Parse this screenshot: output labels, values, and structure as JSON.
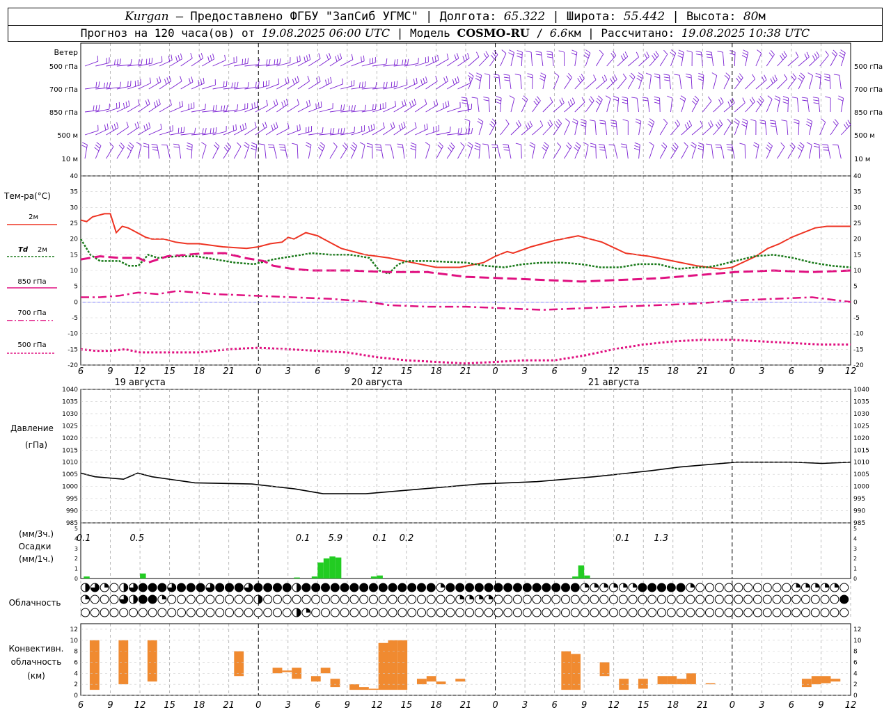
{
  "header": {
    "station": "Kurgan",
    "provider": " – Предоставлено ФГБУ \"ЗапСиб УГМС\" | Долгота: ",
    "lon": "65.322",
    "lat_label": " | Широта: ",
    "lat": "55.442",
    "alt_label": " | Высота: ",
    "alt": "80",
    "alt_unit": "м",
    "line2_a": "Прогноз на 120 часа(ов) от ",
    "issued": "19.08.2025 06:00 UTC",
    "line2_b": "  | Модель ",
    "model": "COSMO-RU",
    "line2_c": " / ",
    "res": "6.6",
    "res_unit": "км | Рассчитано: ",
    "computed": "19.08.2025 10:38 UTC"
  },
  "colors": {
    "wind": "#7a1fd2",
    "t2m": "#ee3322",
    "td2m": "#1a7a1a",
    "t850": "#e01080",
    "pressure": "#000000",
    "precip": "#22cc22",
    "conv": "#f08a30",
    "zero": "#3333ff"
  },
  "labels": {
    "wind": {
      "title": "Ветер",
      "levels": [
        "500 гПа",
        "700 гПа",
        "850 гПа",
        "500 м",
        "10  м"
      ]
    },
    "temp": {
      "title": "Тем-ра(°C)",
      "l2m": "2м",
      "ltd": "Td",
      "ltd2": "2м",
      "l850": "850 гПа",
      "l700": "700 гПа",
      "l500": "500 гПа"
    },
    "pressure": {
      "line1": "Давление",
      "line2": "(гПа)"
    },
    "precip": {
      "line1": "(мм/3ч.)",
      "line2": "Осадки",
      "line3": "(мм/1ч.)"
    },
    "cloud": {
      "title": "Облачность"
    },
    "conv": {
      "line1": "Конвективн.",
      "line2": "облачность",
      "line3": "(км)"
    },
    "days": [
      "19 августа",
      "20 августа",
      "21 августа"
    ]
  },
  "chart_data": {
    "type": "meteogram",
    "x_hours": [
      6,
      9,
      12,
      15,
      18,
      21,
      0,
      3,
      6,
      9,
      12,
      15,
      18,
      21,
      0,
      3,
      6,
      9,
      12,
      15,
      18,
      21,
      0,
      3,
      6,
      9,
      12
    ],
    "temperature": {
      "ylim": [
        -20,
        40
      ],
      "ticks": [
        -20,
        -15,
        -10,
        -5,
        0,
        5,
        10,
        15,
        20,
        25,
        30,
        35,
        40
      ],
      "t2m": [
        [
          0,
          26
        ],
        [
          1,
          25.5
        ],
        [
          2,
          27
        ],
        [
          3,
          27.5
        ],
        [
          4,
          28
        ],
        [
          5,
          28
        ],
        [
          6,
          22
        ],
        [
          7,
          24
        ],
        [
          8,
          23.5
        ],
        [
          9,
          22.5
        ],
        [
          10,
          21.5
        ],
        [
          11,
          20.5
        ],
        [
          12,
          20
        ],
        [
          14,
          20
        ],
        [
          16,
          19
        ],
        [
          18,
          18.5
        ],
        [
          20,
          18.5
        ],
        [
          24,
          17.5
        ],
        [
          28,
          17
        ],
        [
          30,
          17.5
        ],
        [
          32,
          18.5
        ],
        [
          34,
          19
        ],
        [
          35,
          20.5
        ],
        [
          36,
          20
        ],
        [
          38,
          22
        ],
        [
          40,
          21
        ],
        [
          42,
          19
        ],
        [
          44,
          17
        ],
        [
          46,
          16
        ],
        [
          48,
          15
        ],
        [
          52,
          14
        ],
        [
          56,
          12.5
        ],
        [
          60,
          11
        ],
        [
          64,
          11
        ],
        [
          68,
          12.5
        ],
        [
          70,
          14.5
        ],
        [
          72,
          16
        ],
        [
          73,
          15.5
        ],
        [
          76,
          17.5
        ],
        [
          80,
          19.5
        ],
        [
          84,
          21
        ],
        [
          88,
          19
        ],
        [
          92,
          15.5
        ],
        [
          96,
          14.5
        ],
        [
          100,
          13
        ],
        [
          104,
          11.5
        ],
        [
          108,
          10.5
        ],
        [
          110,
          11
        ],
        [
          114,
          14.5
        ],
        [
          116,
          17
        ],
        [
          118,
          18.5
        ],
        [
          120,
          20.5
        ],
        [
          124,
          23.5
        ],
        [
          126,
          24
        ],
        [
          130,
          24
        ]
      ],
      "td2m": [
        [
          0,
          20
        ],
        [
          2,
          15
        ],
        [
          4,
          13
        ],
        [
          6,
          13
        ],
        [
          8,
          13
        ],
        [
          10,
          11.5
        ],
        [
          12,
          11.5
        ],
        [
          14,
          15
        ],
        [
          16,
          14
        ],
        [
          20,
          14.5
        ],
        [
          24,
          14.5
        ],
        [
          28,
          13.5
        ],
        [
          32,
          12.5
        ],
        [
          36,
          12
        ],
        [
          40,
          13.5
        ],
        [
          44,
          14.5
        ],
        [
          48,
          15.5
        ],
        [
          52,
          15
        ],
        [
          56,
          15
        ],
        [
          60,
          14
        ],
        [
          62,
          10
        ],
        [
          64,
          9
        ],
        [
          66,
          12
        ],
        [
          68,
          13
        ],
        [
          72,
          13
        ],
        [
          80,
          12.5
        ],
        [
          84,
          11.5
        ],
        [
          88,
          11
        ],
        [
          92,
          12
        ],
        [
          96,
          12.5
        ],
        [
          100,
          12.5
        ],
        [
          104,
          12
        ],
        [
          108,
          11
        ],
        [
          112,
          11
        ],
        [
          114,
          11.5
        ],
        [
          116,
          12
        ],
        [
          120,
          12
        ],
        [
          124,
          10.5
        ],
        [
          128,
          11
        ],
        [
          130,
          11
        ],
        [
          132,
          11.5
        ],
        [
          136,
          13
        ],
        [
          140,
          14.5
        ],
        [
          144,
          15
        ],
        [
          148,
          14
        ],
        [
          152,
          12.5
        ],
        [
          156,
          11.5
        ],
        [
          160,
          11
        ]
      ],
      "t850": [
        [
          0,
          13.5
        ],
        [
          4,
          14.5
        ],
        [
          8,
          14
        ],
        [
          12,
          14
        ],
        [
          14,
          12.5
        ],
        [
          18,
          14.5
        ],
        [
          22,
          15
        ],
        [
          26,
          15.5
        ],
        [
          30,
          15.5
        ],
        [
          34,
          14
        ],
        [
          38,
          13
        ],
        [
          40,
          11.5
        ],
        [
          44,
          10.5
        ],
        [
          48,
          10
        ],
        [
          56,
          10
        ],
        [
          64,
          9.5
        ],
        [
          72,
          9.5
        ],
        [
          80,
          8
        ],
        [
          88,
          7.5
        ],
        [
          96,
          7
        ],
        [
          104,
          6.5
        ],
        [
          112,
          7
        ],
        [
          120,
          7.5
        ],
        [
          128,
          8.5
        ],
        [
          136,
          9.5
        ],
        [
          144,
          10
        ],
        [
          152,
          9.5
        ],
        [
          160,
          10
        ]
      ],
      "t700": [
        [
          0,
          1.5
        ],
        [
          4,
          1.5
        ],
        [
          8,
          2
        ],
        [
          12,
          3
        ],
        [
          16,
          2.5
        ],
        [
          20,
          3.5
        ],
        [
          28,
          2.5
        ],
        [
          36,
          2
        ],
        [
          44,
          1.5
        ],
        [
          52,
          1
        ],
        [
          60,
          0
        ],
        [
          64,
          -1
        ],
        [
          72,
          -1.5
        ],
        [
          80,
          -1.5
        ],
        [
          88,
          -2
        ],
        [
          96,
          -2.5
        ],
        [
          104,
          -2
        ],
        [
          112,
          -1.5
        ],
        [
          120,
          -1
        ],
        [
          128,
          -0.5
        ],
        [
          136,
          0.5
        ],
        [
          144,
          1
        ],
        [
          152,
          1.5
        ],
        [
          160,
          0
        ]
      ],
      "t500": [
        [
          0,
          -15
        ],
        [
          4,
          -15.5
        ],
        [
          8,
          -15.5
        ],
        [
          12,
          -15
        ],
        [
          16,
          -16
        ],
        [
          24,
          -16
        ],
        [
          32,
          -16
        ],
        [
          40,
          -15
        ],
        [
          48,
          -14.5
        ],
        [
          56,
          -15
        ],
        [
          64,
          -15.5
        ],
        [
          72,
          -16
        ],
        [
          80,
          -17.5
        ],
        [
          88,
          -18.5
        ],
        [
          96,
          -19
        ],
        [
          104,
          -19.5
        ],
        [
          112,
          -19
        ],
        [
          120,
          -18.5
        ],
        [
          128,
          -18.5
        ],
        [
          136,
          -17
        ],
        [
          144,
          -15
        ],
        [
          152,
          -13.5
        ],
        [
          160,
          -12.5
        ],
        [
          168,
          -12
        ],
        [
          176,
          -12
        ],
        [
          184,
          -12.5
        ],
        [
          192,
          -13
        ],
        [
          200,
          -13.5
        ],
        [
          208,
          -13.5
        ]
      ]
    },
    "pressure": {
      "ylim": [
        985,
        1040
      ],
      "ticks": [
        985,
        990,
        995,
        1000,
        1005,
        1010,
        1015,
        1020,
        1025,
        1030,
        1035,
        1040
      ],
      "values": [
        [
          0,
          1005.5
        ],
        [
          3,
          1004
        ],
        [
          6,
          1003.5
        ],
        [
          9,
          1003
        ],
        [
          12,
          1005.5
        ],
        [
          15,
          1004
        ],
        [
          24,
          1001.5
        ],
        [
          36,
          1001
        ],
        [
          45,
          999
        ],
        [
          51,
          997
        ],
        [
          60,
          997
        ],
        [
          72,
          999
        ],
        [
          84,
          1001
        ],
        [
          96,
          1002
        ],
        [
          108,
          1004
        ],
        [
          120,
          1006.5
        ],
        [
          126,
          1008
        ],
        [
          132,
          1009
        ],
        [
          138,
          1010
        ],
        [
          150,
          1010
        ],
        [
          156,
          1009.5
        ],
        [
          162,
          1010
        ]
      ]
    },
    "precip": {
      "ylim": [
        0,
        5
      ],
      "ticks": [
        0,
        1,
        2,
        3,
        4,
        5
      ],
      "bars_1h": [
        [
          0.5,
          0.2
        ],
        [
          10,
          0.5
        ],
        [
          36,
          0.1
        ],
        [
          39,
          0.2
        ],
        [
          40,
          1.6
        ],
        [
          41,
          2
        ],
        [
          42,
          2.2
        ],
        [
          43,
          2.1
        ],
        [
          49,
          0.2
        ],
        [
          50,
          0.3
        ],
        [
          83,
          0.2
        ],
        [
          84,
          1.3
        ],
        [
          85,
          0.3
        ]
      ],
      "sums_3h": [
        [
          "0.1",
          0.5
        ],
        [
          "0.5",
          9.5
        ],
        [
          "0.1",
          37.5
        ],
        [
          "5.9",
          43
        ],
        [
          "0.1",
          50.5
        ],
        [
          "0.2",
          55
        ],
        [
          "0.1",
          91.5
        ],
        [
          "1.3",
          98
        ]
      ]
    },
    "cloud": {
      "columns": 80,
      "note": "rows: high, middle, low; codes: 0 clear, 1 quarter, 2 half, 3 three-quarters, 4 overcast",
      "high": [
        2,
        3,
        1,
        0,
        2,
        3,
        4,
        4,
        4,
        3,
        4,
        4,
        4,
        3,
        4,
        4,
        4,
        3,
        4,
        4,
        4,
        4,
        2,
        4,
        4,
        4,
        4,
        4,
        4,
        4,
        4,
        4,
        4,
        4,
        4,
        4,
        4,
        1,
        4,
        4,
        4,
        4,
        4,
        4,
        4,
        4,
        4,
        4,
        4,
        4,
        4,
        4,
        1,
        1,
        1,
        1,
        1,
        1,
        4,
        4,
        4,
        4,
        4,
        1,
        0,
        0,
        0,
        0,
        0,
        0,
        0,
        0,
        0,
        0,
        1,
        1,
        1,
        1,
        1,
        0
      ],
      "mid": [
        1,
        0,
        0,
        0,
        3,
        2,
        4,
        4,
        1,
        0,
        0,
        0,
        0,
        0,
        0,
        0,
        0,
        0,
        2,
        0,
        0,
        0,
        0,
        0,
        0,
        0,
        0,
        0,
        0,
        0,
        0,
        0,
        0,
        0,
        0,
        0,
        0,
        0,
        0,
        1,
        1,
        1,
        1,
        0,
        0,
        0,
        0,
        0,
        0,
        0,
        0,
        0,
        0,
        0,
        0,
        0,
        0,
        0,
        0,
        0,
        0,
        0,
        0,
        0,
        0,
        0,
        0,
        0,
        0,
        0,
        0,
        0,
        0,
        0,
        0,
        0,
        0,
        0,
        0,
        4
      ],
      "low": [
        0,
        0,
        0,
        0,
        0,
        0,
        0,
        0,
        0,
        0,
        0,
        0,
        0,
        0,
        0,
        0,
        0,
        0,
        0,
        0,
        0,
        0,
        2,
        1,
        0,
        0,
        0,
        0,
        0,
        0,
        0,
        0,
        0,
        0,
        0,
        0,
        0,
        0,
        0,
        0,
        0,
        0,
        0,
        0,
        0,
        0,
        0,
        0,
        0,
        0,
        0,
        0,
        0,
        0,
        0,
        0,
        0,
        0,
        0,
        0,
        0,
        0,
        0,
        0,
        0,
        0,
        0,
        0,
        0,
        0,
        0,
        0,
        0,
        0,
        0,
        0,
        0,
        0,
        0,
        0
      ]
    },
    "conv": {
      "ylim": [
        0,
        13
      ],
      "ticks": [
        0,
        2,
        4,
        6,
        8,
        10,
        12
      ],
      "bars": [
        [
          1,
          1,
          10
        ],
        [
          4,
          2,
          10
        ],
        [
          7,
          2.5,
          10
        ],
        [
          16,
          3.5,
          8
        ],
        [
          20,
          4,
          5
        ],
        [
          21,
          4.2,
          4.5
        ],
        [
          22,
          3,
          5
        ],
        [
          24,
          2.5,
          3.5
        ],
        [
          25,
          4,
          5
        ],
        [
          26,
          1.5,
          3
        ],
        [
          28,
          1,
          2
        ],
        [
          29,
          1,
          1.5
        ],
        [
          30,
          1,
          1.2
        ],
        [
          31,
          1,
          9.5
        ],
        [
          32,
          1,
          10
        ],
        [
          33,
          1,
          10
        ],
        [
          35,
          2,
          3
        ],
        [
          36,
          2.5,
          3.5
        ],
        [
          37,
          2,
          2.5
        ],
        [
          39,
          2.5,
          3
        ],
        [
          50,
          1,
          8
        ],
        [
          51,
          1,
          7.5
        ],
        [
          54,
          3.5,
          6
        ],
        [
          56,
          1,
          3
        ],
        [
          58,
          1.2,
          3
        ],
        [
          60,
          2,
          3.5
        ],
        [
          61,
          2,
          3.5
        ],
        [
          62,
          2,
          3
        ],
        [
          63,
          2,
          4
        ],
        [
          65,
          2,
          2.2
        ],
        [
          75,
          1.5,
          3
        ],
        [
          76,
          2,
          3.5
        ],
        [
          77,
          2.2,
          3.5
        ],
        [
          78,
          2.5,
          3
        ]
      ]
    }
  }
}
